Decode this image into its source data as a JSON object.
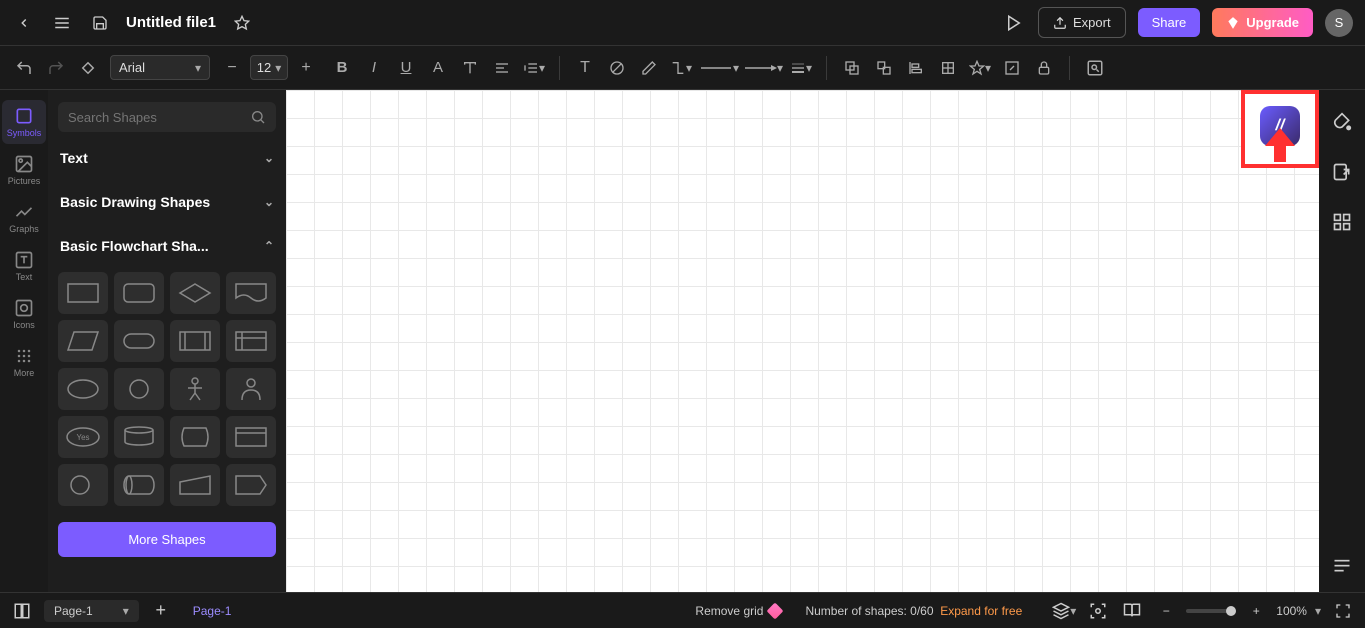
{
  "topbar": {
    "file_title": "Untitled file1",
    "export_label": "Export",
    "share_label": "Share",
    "upgrade_label": "Upgrade",
    "avatar_initial": "S"
  },
  "toolbar": {
    "font_family": "Arial",
    "font_size": "12"
  },
  "nav": {
    "items": [
      {
        "label": "Symbols"
      },
      {
        "label": "Pictures"
      },
      {
        "label": "Graphs"
      },
      {
        "label": "Text"
      },
      {
        "label": "Icons"
      },
      {
        "label": "More"
      }
    ]
  },
  "shapes": {
    "search_placeholder": "Search Shapes",
    "cat_text": "Text",
    "cat_basic_drawing": "Basic Drawing Shapes",
    "cat_basic_flowchart": "Basic Flowchart Sha...",
    "more_shapes_label": "More Shapes",
    "yes_label": "Yes"
  },
  "bottombar": {
    "page_select": "Page-1",
    "page_tab": "Page-1",
    "remove_grid": "Remove grid",
    "shapes_count_prefix": "Number of shapes: ",
    "shapes_count_value": "0/60",
    "expand_free": "Expand for free",
    "zoom_value": "100%"
  }
}
